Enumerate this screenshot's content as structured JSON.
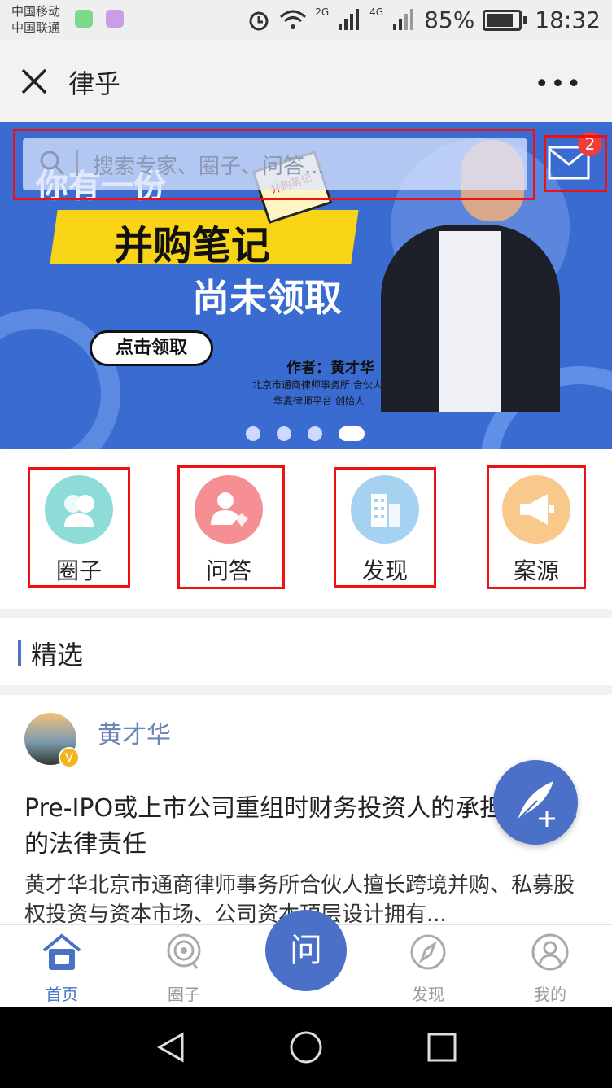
{
  "status_bar": {
    "carrier1": "中国移动",
    "carrier2": "中国联通",
    "net1": "2G",
    "net2": "4G",
    "battery": "85%",
    "time": "18:32"
  },
  "titlebar": {
    "title": "律乎",
    "more": "•••"
  },
  "banner": {
    "search_placeholder": "搜索专家、圈子、问答...",
    "message_badge": "2",
    "line1": "你有一份",
    "line2": "并购笔记",
    "line3": "尚未领取",
    "book_label": "并购笔记",
    "claim_button": "点击领取",
    "author": "作者：黄才华",
    "author_title1": "北京市通商律师事务所 合伙人",
    "author_title2": "华麦律师平台 创始人",
    "carousel_count": 4,
    "carousel_active": 4
  },
  "quick_nav": [
    {
      "label": "圈子",
      "color": "#8ddcd8",
      "icon": "group-icon"
    },
    {
      "label": "问答",
      "color": "#f58f93",
      "icon": "qa-icon"
    },
    {
      "label": "发现",
      "color": "#a6d2f2",
      "icon": "building-icon"
    },
    {
      "label": "案源",
      "color": "#f8c98a",
      "icon": "megaphone-icon"
    }
  ],
  "section": {
    "title": "精选"
  },
  "post": {
    "author": "黄才华",
    "verified": "V",
    "title": "Pre-IPO或上市公司重组时财务投资人的承担及产生的法律责任",
    "summary": "黄才华北京市通商律师事务所合伙人擅长跨境并购、私募股权投资与资本市场、公司资本顶层设计拥有..."
  },
  "tabbar": {
    "home": "首页",
    "circle": "圈子",
    "ask": "问",
    "discover": "发现",
    "mine": "我的"
  },
  "colors": {
    "accent": "#4b70c8",
    "highlight_box": "#e11111"
  }
}
